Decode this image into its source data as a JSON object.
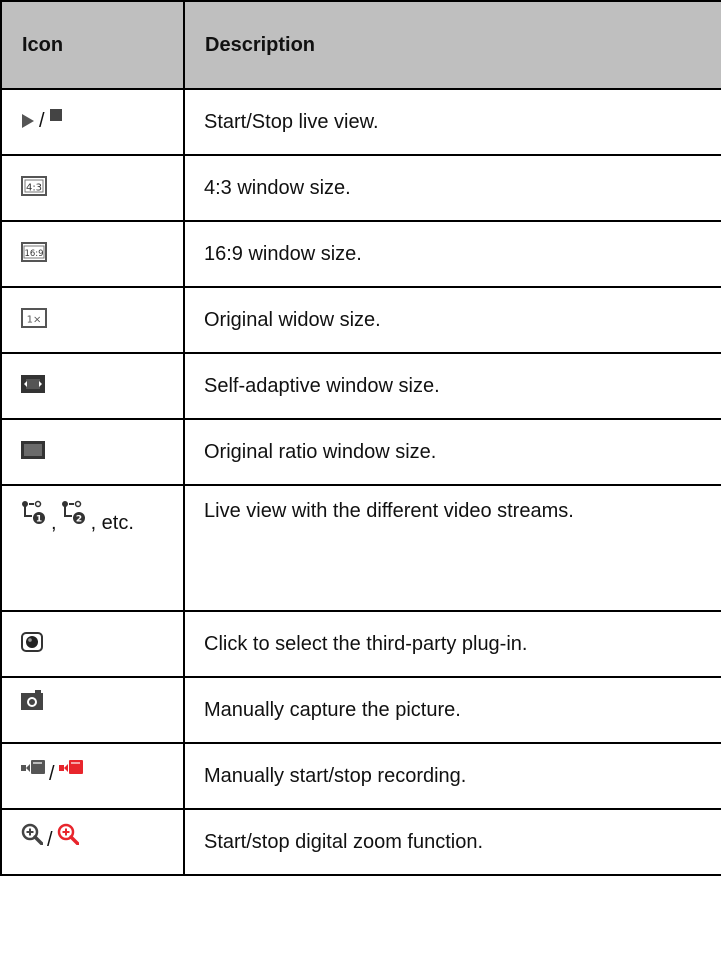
{
  "table": {
    "headers": {
      "icon": "Icon",
      "description": "Description"
    },
    "rows": [
      {
        "icons": [
          "play-icon",
          "stop-icon"
        ],
        "separator": "/",
        "description": "Start/Stop live view."
      },
      {
        "icons": [
          "aspect-4-3-icon"
        ],
        "icon_text": "4:3",
        "description": "4:3 window size."
      },
      {
        "icons": [
          "aspect-16-9-icon"
        ],
        "icon_text": "16:9",
        "description": "16:9 window size."
      },
      {
        "icons": [
          "original-size-icon"
        ],
        "icon_text": "1×",
        "description": "Original widow size."
      },
      {
        "icons": [
          "self-adaptive-icon"
        ],
        "description": "Self-adaptive window size."
      },
      {
        "icons": [
          "original-ratio-icon"
        ],
        "description": "Original ratio window size."
      },
      {
        "icons": [
          "stream-1-icon",
          "stream-2-icon"
        ],
        "separator": ",",
        "suffix": ", etc.",
        "description": "Live view with the different video streams."
      },
      {
        "icons": [
          "third-party-plugin-icon"
        ],
        "description": "Click to select the third-party plug-in."
      },
      {
        "icons": [
          "camera-icon"
        ],
        "description": "Manually capture the picture."
      },
      {
        "icons": [
          "record-icon",
          "record-active-icon"
        ],
        "separator": "/",
        "description": "Manually start/stop recording."
      },
      {
        "icons": [
          "zoom-icon",
          "zoom-active-icon"
        ],
        "separator": "/",
        "description": "Start/stop digital zoom function."
      }
    ]
  },
  "colors": {
    "header_bg": "#bfbfbf",
    "border": "#000000",
    "icon_gray": "#555555",
    "active_red": "#e8252c"
  }
}
